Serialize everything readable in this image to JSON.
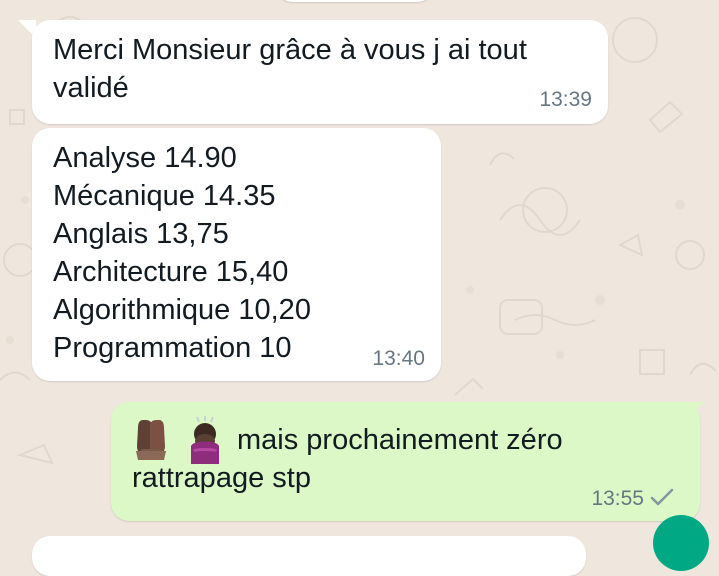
{
  "chat": {
    "messages": [
      {
        "direction": "incoming",
        "text": "Merci Monsieur grâce à vous j ai tout\nvalidé",
        "time": "13:39"
      },
      {
        "direction": "incoming",
        "text": "Analyse 14.90\nMécanique 14.35\nAnglais 13,75\nArchitecture 15,40\nAlgorithmique 10,20\nProgrammation 10",
        "time": "13:40"
      },
      {
        "direction": "outgoing",
        "text": "mais prochainement zéro\nrattrapage stp",
        "time": "13:55",
        "status": "sent-check-icon",
        "emojis": [
          "praying-hands-icon",
          "bowing-person-icon"
        ]
      }
    ]
  },
  "colors": {
    "background": "#efe7de",
    "incoming_bubble": "#ffffff",
    "outgoing_bubble": "#dcf8c6",
    "text": "#111b21",
    "timestamp": "#667781",
    "accent": "#00a884"
  }
}
